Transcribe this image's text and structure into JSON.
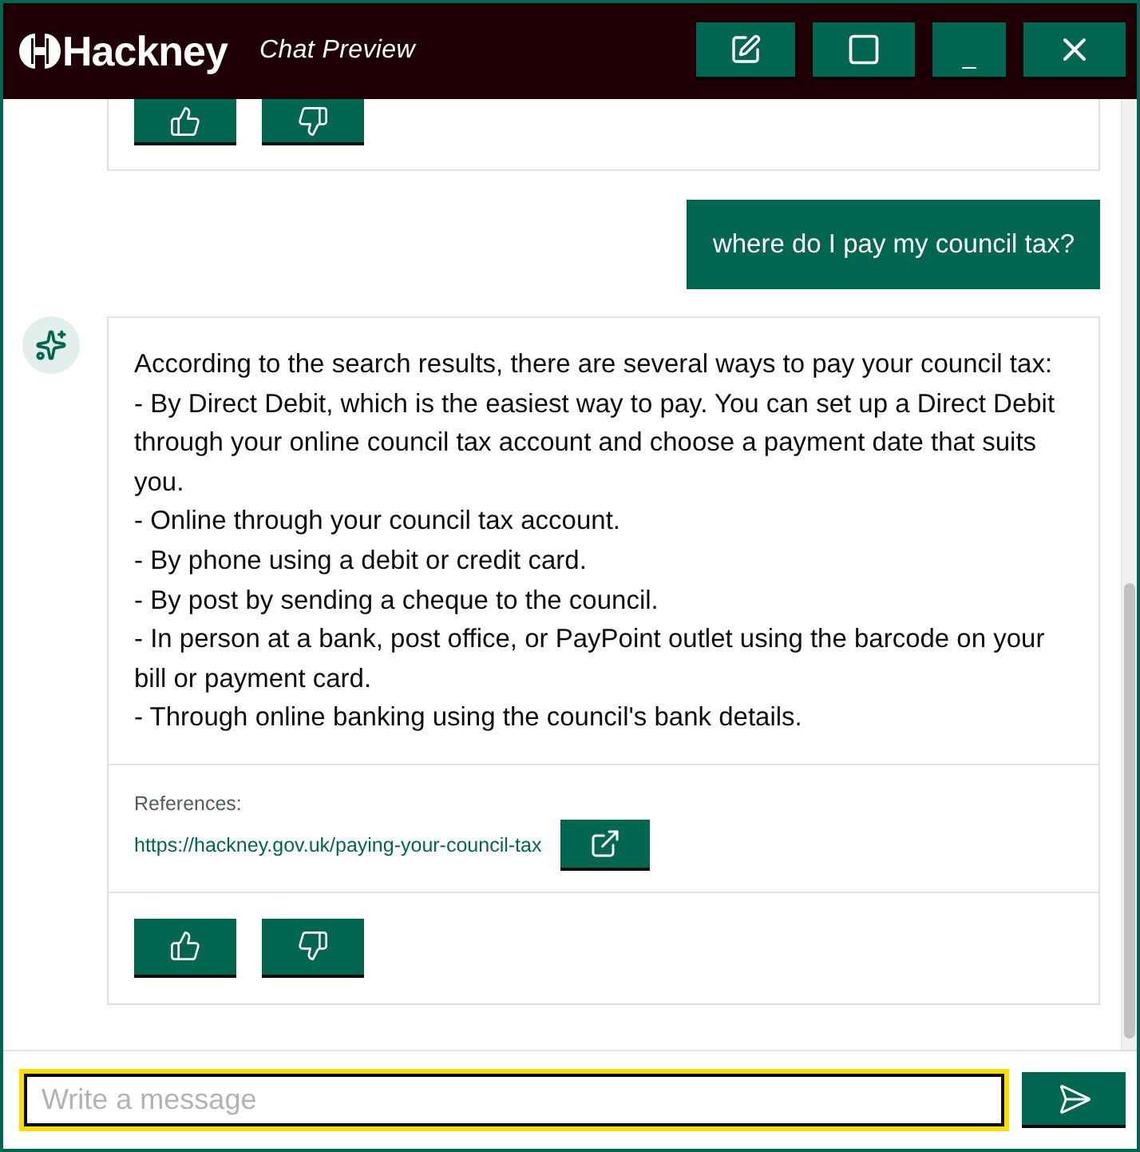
{
  "window": {
    "logo": "Hackney",
    "title": "Chat Preview",
    "controls": [
      {
        "kind": "edit"
      },
      {
        "kind": "maximize"
      },
      {
        "kind": "minimize",
        "label": "_"
      },
      {
        "kind": "close"
      }
    ]
  },
  "messages": [
    {
      "kind": "tail",
      "feedback": [
        {
          "kind": "like"
        },
        {
          "kind": "dislike"
        }
      ]
    },
    {
      "kind": "user",
      "text": "where do I pay my council tax?"
    },
    {
      "kind": "assistant",
      "lines": [
        "According to the search results, there are several ways to pay your council tax:",
        "- By Direct Debit, which is the easiest way to pay. You can set up a Direct Debit through your online council tax account and choose a payment date that suits you.",
        "- Online through your council tax account.",
        "- By phone using a debit or credit card.",
        "- By post by sending a cheque to the council.",
        "- In person at a bank, post office, or PayPoint outlet using the barcode on your bill or payment card.",
        "- Through online banking using the council's bank details."
      ],
      "references": {
        "label": "References:",
        "links": [
          "https://hackney.gov.uk/paying-your-council-tax"
        ]
      },
      "feedback": [
        {
          "kind": "like"
        },
        {
          "kind": "dislike"
        }
      ]
    }
  ],
  "composer": {
    "placeholder": "Write a message",
    "focused": true
  }
}
